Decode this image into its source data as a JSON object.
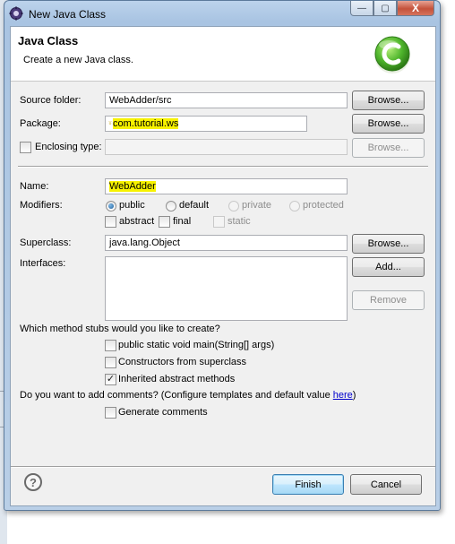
{
  "window": {
    "title": "New Java Class",
    "close_glyph": "X",
    "minimize_glyph": "—",
    "maximize_glyph": "▢"
  },
  "banner": {
    "title": "Java Class",
    "description": "Create a new Java class.",
    "logo_icon": "class-wizard-c-icon"
  },
  "form": {
    "source_folder": {
      "label": "Source folder:",
      "value": "WebAdder/src",
      "button": "Browse..."
    },
    "package": {
      "label": "Package:",
      "value": "com.tutorial.ws",
      "button": "Browse..."
    },
    "enclosing_type": {
      "label": "Enclosing type:",
      "value": "",
      "button": "Browse...",
      "checked": false
    },
    "name": {
      "label": "Name:",
      "value": "WebAdder"
    },
    "modifiers": {
      "label": "Modifiers:",
      "access": [
        {
          "label": "public",
          "selected": true,
          "enabled": true
        },
        {
          "label": "default",
          "selected": false,
          "enabled": true
        },
        {
          "label": "private",
          "selected": false,
          "enabled": false
        },
        {
          "label": "protected",
          "selected": false,
          "enabled": false
        }
      ],
      "flags": [
        {
          "label": "abstract",
          "checked": false,
          "enabled": true
        },
        {
          "label": "final",
          "checked": false,
          "enabled": true
        },
        {
          "label": "static",
          "checked": false,
          "enabled": false
        }
      ]
    },
    "superclass": {
      "label": "Superclass:",
      "value": "java.lang.Object",
      "button": "Browse..."
    },
    "interfaces": {
      "label": "Interfaces:",
      "add_button": "Add...",
      "remove_button": "Remove"
    }
  },
  "stubs": {
    "question": "Which method stubs would you like to create?",
    "options": [
      {
        "label": "public static void main(String[] args)",
        "checked": false
      },
      {
        "label": "Constructors from superclass",
        "checked": false
      },
      {
        "label": "Inherited abstract methods",
        "checked": true
      }
    ]
  },
  "comments": {
    "question": "Do you want to add comments? (Configure templates and default value ",
    "link": "here",
    "close_paren": ")",
    "option": {
      "label": "Generate comments",
      "checked": false
    }
  },
  "footer": {
    "help_glyph": "?",
    "finish": "Finish",
    "cancel": "Cancel"
  },
  "colors": {
    "highlight": "#f7f200",
    "default_button_border": "#3c7fb1",
    "link": "#0000cc"
  }
}
